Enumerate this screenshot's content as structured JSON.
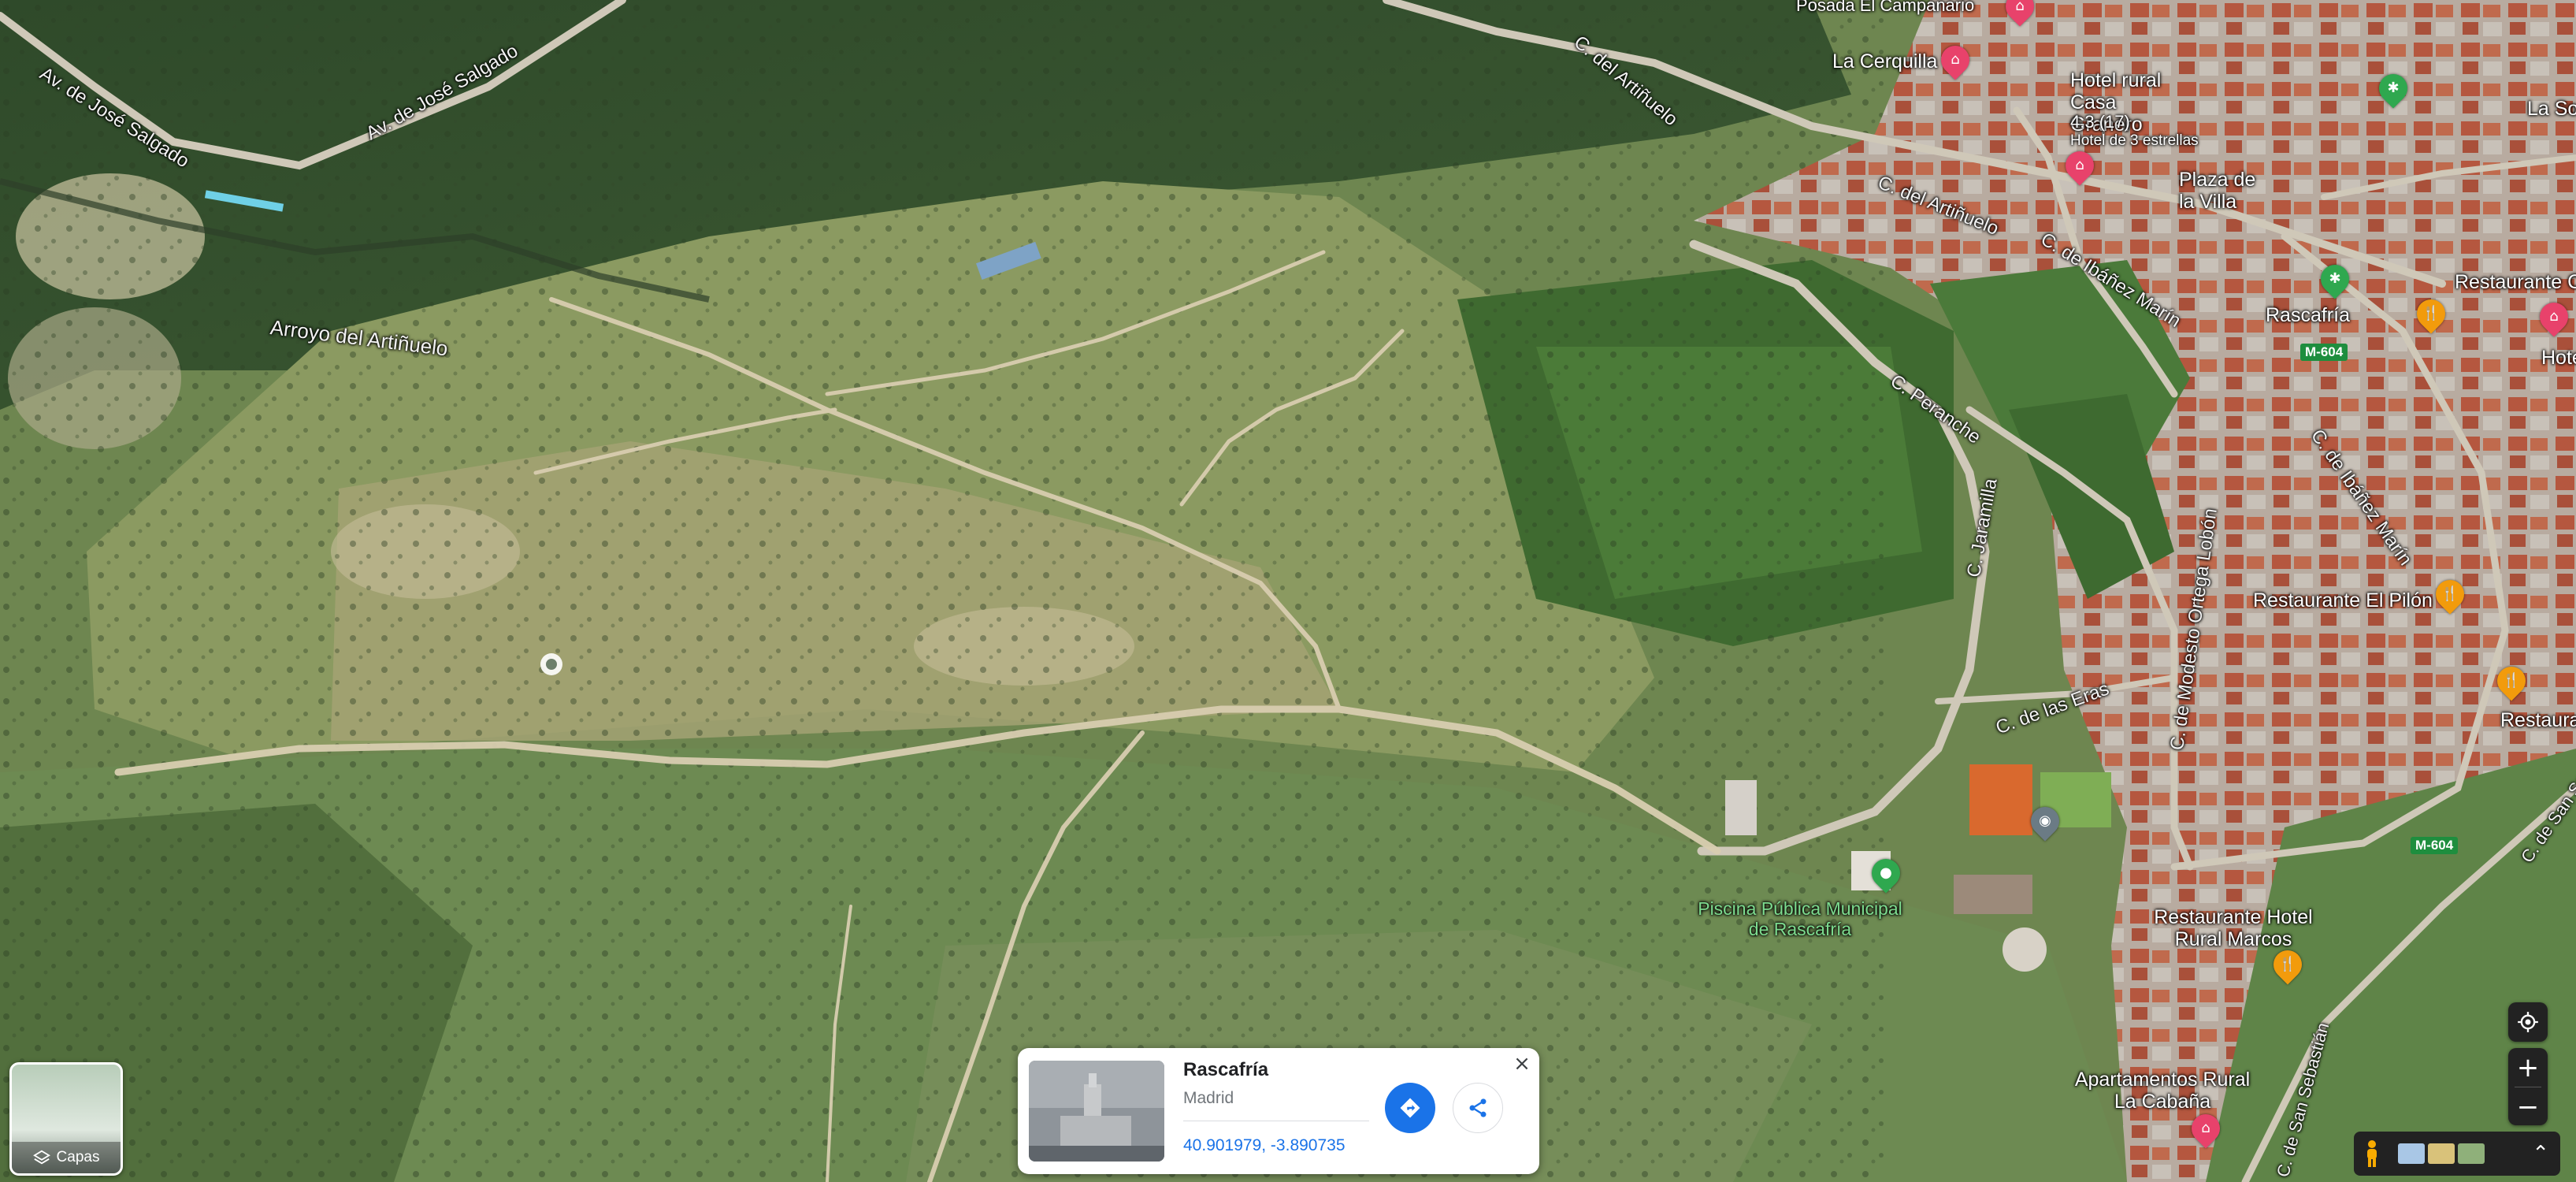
{
  "map": {
    "type": "satellite",
    "road_labels": {
      "av_salgado_1": "Av. de José Salgado",
      "av_salgado_2": "Av. de José Salgado",
      "arroyo": "Arroyo del Artiñuelo",
      "c_artinuelo_1": "C. del Artiñuelo",
      "c_artinuelo_2": "C. del Artiñuelo",
      "c_ibanez_1": "C. de Ibáñez Marín",
      "c_ibanez_2": "C. de Ibáñez Marín",
      "c_peranche": "C. Peranche",
      "c_jaramilla": "C. Jaramilla",
      "c_eras": "C. de las Eras",
      "c_modesto": "C. de Modesto Ortega Lobón",
      "c_san_sebastian_1": "C. de San Sebastián",
      "c_san_sebastian_2": "C. de San Sebastián"
    },
    "places": {
      "posada": "Posada El Campanario",
      "cerquilla": "La Cerquilla",
      "hotel_granero": "Hotel rural Casa Granero",
      "hotel_granero_rating": "4.3 (17)",
      "hotel_granero_class": "Hotel de 3 estrellas",
      "plaza": "Plaza de la Villa",
      "rascafria": "Rascafría",
      "restaurante_conc": "Restaurante Conc",
      "hotel_r": "Hotel de R",
      "la_sol": "La Sol",
      "pilon": "Restaurante El Pilón",
      "restaurante_edge": "Restaura",
      "piscina": "Piscina Pública Municipal de Rascafría",
      "marcos": "Restaurante Hotel Rural Marcos",
      "apartamentos": "Apartamentos Rural La Cabaña"
    },
    "shields": {
      "m604_a": "M-604",
      "m604_b": "M-604"
    }
  },
  "layers": {
    "label": "Capas",
    "icon": "layers-icon"
  },
  "place_card": {
    "name": "Rascafría",
    "region": "Madrid",
    "coordinates": "40.901979, -3.890735",
    "directions_icon": "directions-icon",
    "share_icon": "share-icon",
    "close_icon": "close-icon"
  },
  "controls": {
    "zoom_in": "+",
    "zoom_out": "−",
    "locate_icon": "my-location-icon",
    "pegman_icon": "pegman-icon",
    "expand": "⌃"
  }
}
